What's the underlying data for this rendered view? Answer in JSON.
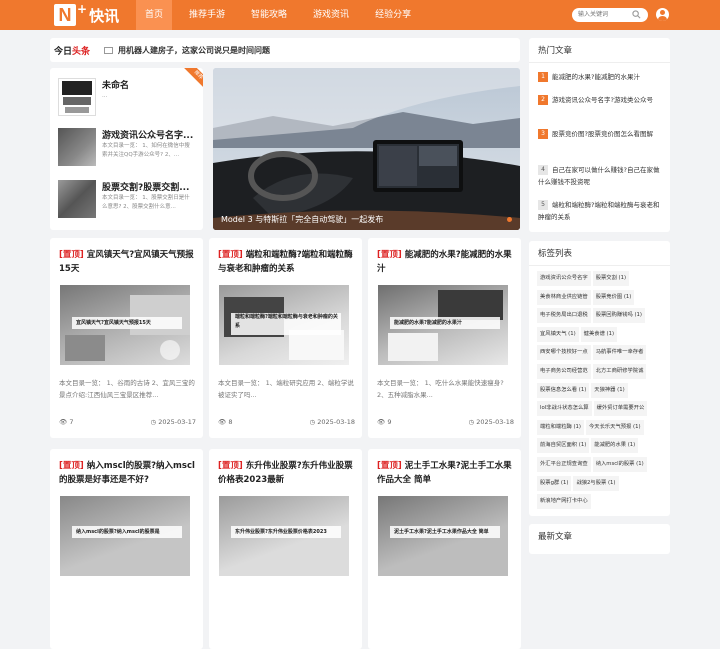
{
  "brand": {
    "logo_letter": "N",
    "logo_plus": "+",
    "logo_text": "快讯",
    "accent": "#f0782d"
  },
  "nav": {
    "items": [
      {
        "label": "首页",
        "active": true
      },
      {
        "label": "推荐手游"
      },
      {
        "label": "智能攻略"
      },
      {
        "label": "游戏资讯"
      },
      {
        "label": "经验分享"
      }
    ]
  },
  "search": {
    "placeholder": "输入关键词"
  },
  "headline": {
    "logo_a": "今日",
    "logo_b": "头条",
    "text": "用机器人建房子，这家公司说只是时间问题"
  },
  "left_list": {
    "ribbon": "推荐",
    "items": [
      {
        "title": "未命名",
        "desc": "..."
      },
      {
        "title": "游戏资讯公众号名字...",
        "desc": "本文目录一览： 1、如何在微信中搜索并关注QQ手游公众号? 2、..."
      },
      {
        "title": "股票交割?股票交割...",
        "desc": "本文目录一览： 1、股票交割日是什么意思? 2、股票交割什么意..."
      }
    ]
  },
  "hero": {
    "caption": "Model 3 与特斯拉「完全自动驾驶」一起发布"
  },
  "cards": [
    {
      "tag": "[置顶]",
      "title": "宜风镇天气?宜风镇天气预报15天",
      "img_label": "宜风镇天气?宜风镇天气预报15天",
      "desc": "本文目录一览： 1、谷雨的古诗 2、宜风三宝的景点介绍:江西仙风三宝景区推荐...",
      "views": "7",
      "date": "2025-03-17"
    },
    {
      "tag": "[置顶]",
      "title": "端粒和端粒酶?端粒和端粒酶与衰老和肿瘤的关系",
      "img_label": "端粒和端粒酶?端粒和端粒酶与衰老和肿瘤的关系",
      "desc": "本文目录一览： 1、端粒研究应用 2、端粒学说被证实了吗...",
      "views": "8",
      "date": "2025-03-18"
    },
    {
      "tag": "[置顶]",
      "title": "能减肥的水果?能减肥的水果汁",
      "img_label": "能减肥的水果?能减肥的水果汁",
      "desc": "本文目录一览： 1、吃什么水果能快速瘦身? 2、五种减脂水果...",
      "views": "9",
      "date": "2025-03-18"
    },
    {
      "tag": "[置顶]",
      "title": "纳入mscl的股票?纳入mscl的股票是好事还是不好?",
      "img_label": "纳入mscl的股票?纳入mscl的股票是",
      "desc": "",
      "views": "",
      "date": ""
    },
    {
      "tag": "[置顶]",
      "title": "东升伟业股票?东升伟业股票价格表2023最新",
      "img_label": "东升伟业股票?东升伟业股票价格表2023",
      "desc": "",
      "views": "",
      "date": ""
    },
    {
      "tag": "[置顶]",
      "title": "泥土手工水果?泥土手工水果作品大全 简单",
      "img_label": "泥土手工水果?泥土手工水果作品大全 简单",
      "desc": "",
      "views": "",
      "date": ""
    }
  ],
  "hot": {
    "title": "热门文章",
    "items": [
      {
        "num": "1",
        "text": "能减肥的水果?能减肥的水果汁"
      },
      {
        "num": "2",
        "text": "游戏资讯公众号名字?游戏类公众号"
      },
      {
        "num": "3",
        "text": "股票竞价图?股票竞价图怎么看图解"
      },
      {
        "num": "4",
        "text": "自己在家可以做什么赚钱?自己在家做什么赚钱不投资呢"
      },
      {
        "num": "5",
        "text": "端粒和端粒酶?端粒和端粒酶与衰老和肿瘤的关系"
      }
    ]
  },
  "tags": {
    "title": "标签列表",
    "items": [
      "游戏资讯公众号名字",
      "股票交割 (1)",
      "美食林商业供应链管",
      "股票竞价图 (1)",
      "电子税务局出口退税",
      "股票回购赚钱吗 (1)",
      "宜风镇天气 (1)",
      "健美食谱 (1)",
      "西安哪个技校好一点",
      "马航事件唯一幸存者",
      "电子商务公司经营范",
      "北方工商研修学院诚",
      "股票信息怎么看 (1)",
      "天狼神器 (1)",
      "lol非战斗状态怎么算",
      "缓外贸订单需要开公",
      "端粒和端粒酶 (1)",
      "今天长乐天气预报 (1)",
      "前海自贸区面积 (1)",
      "能减肥的水果 (1)",
      "外汇平台正规查询查",
      "纳入mscl的股票 (1)",
      "股票g群 (1)",
      "战狼2与股票 (1)",
      "新浪地产网打卡中心"
    ]
  },
  "latest": {
    "title": "最新文章"
  }
}
